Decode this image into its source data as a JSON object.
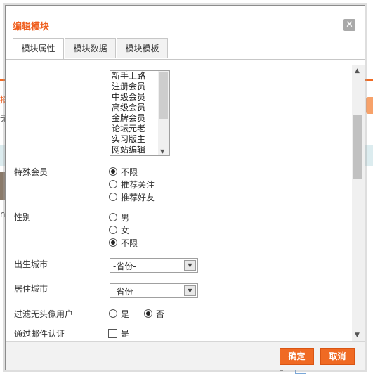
{
  "dialog": {
    "title": "编辑模块",
    "close_symbol": "✕",
    "tabs": [
      {
        "label": "模块属性",
        "active": true
      },
      {
        "label": "模块数据",
        "active": false
      },
      {
        "label": "模块模板",
        "active": false
      }
    ]
  },
  "background": {
    "left_text_1": "摘",
    "left_text_2": "无",
    "left_text_3": "n"
  },
  "form": {
    "member_groups": [
      "新手上路",
      "注册会员",
      "中级会员",
      "高级会员",
      "金牌会员",
      "论坛元老",
      "实习版主",
      "网站编辑"
    ],
    "special_member": {
      "label": "特殊会员",
      "options": [
        {
          "label": "不限",
          "checked": true
        },
        {
          "label": "推荐关注",
          "checked": false
        },
        {
          "label": "推荐好友",
          "checked": false
        }
      ]
    },
    "gender": {
      "label": "性别",
      "options": [
        {
          "label": "男",
          "checked": false
        },
        {
          "label": "女",
          "checked": false
        },
        {
          "label": "不限",
          "checked": true
        }
      ]
    },
    "birth_city": {
      "label": "出生城市",
      "value": "-省份-"
    },
    "live_city": {
      "label": "居住城市",
      "value": "-省份-"
    },
    "filter_no_avatar": {
      "label": "过滤无头像用户",
      "options": [
        {
          "label": "是",
          "checked": false
        },
        {
          "label": "否",
          "checked": true
        }
      ]
    },
    "email_verified": {
      "label": "通过邮件认证",
      "option_label": "是",
      "checked": false
    }
  },
  "footer": {
    "confirm_label": "确定",
    "cancel_label": "取消"
  },
  "colors": {
    "accent": "#f06a23",
    "title": "#ef5f1f"
  }
}
